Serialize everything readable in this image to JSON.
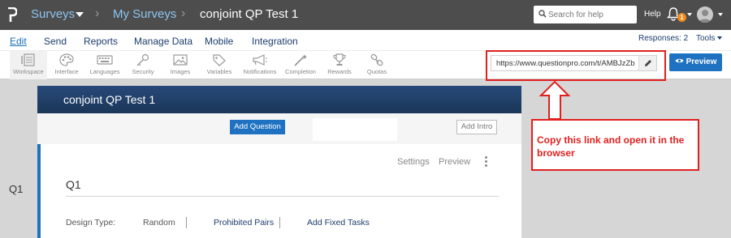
{
  "topbar": {
    "crumb_surveys": "Surveys",
    "crumb_my_surveys": "My Surveys",
    "survey_title": "conjoint QP Test 1",
    "search_placeholder": "Search for help",
    "help_label": "Help",
    "notification_count": "1"
  },
  "menu": {
    "items": [
      "Edit",
      "Send",
      "Reports",
      "Manage Data",
      "Mobile",
      "Integration"
    ],
    "responses": "Responses: 2",
    "tools": "Tools"
  },
  "toolbar": {
    "tools": [
      {
        "label": "Workspace",
        "icon": "workspace-icon"
      },
      {
        "label": "Interface",
        "icon": "palette-icon"
      },
      {
        "label": "Languages",
        "icon": "keyboard-icon"
      },
      {
        "label": "Security",
        "icon": "key-icon"
      },
      {
        "label": "Images",
        "icon": "image-icon"
      },
      {
        "label": "Variables",
        "icon": "tag-icon"
      },
      {
        "label": "Notifications",
        "icon": "megaphone-icon"
      },
      {
        "label": "Completion",
        "icon": "wand-icon"
      },
      {
        "label": "Rewards",
        "icon": "trophy-icon"
      },
      {
        "label": "Quotas",
        "icon": "link-chain-icon"
      }
    ],
    "survey_link": "https://www.questionpro.com/t/AMBJzZb",
    "preview_label": "Preview"
  },
  "annotation": {
    "callout_text": "Copy this link and open it in the browser",
    "color": "#e0201f"
  },
  "panel": {
    "title": "conjoint QP Test 1",
    "add_question": "Add Question",
    "add_intro": "Add Intro"
  },
  "question": {
    "side_label": "Q1",
    "name": "Q1",
    "settings": "Settings",
    "preview": "Preview",
    "design_type_label": "Design Type:",
    "design_type_value": "Random",
    "prohibited_pairs": "Prohibited Pairs",
    "add_fixed_tasks": "Add Fixed Tasks"
  },
  "colors": {
    "topbar": "#4d4d4d",
    "accent_blue": "#1f72c2",
    "panel_header": "#1d3b62",
    "breadcrumb": "#8ec5f0"
  }
}
